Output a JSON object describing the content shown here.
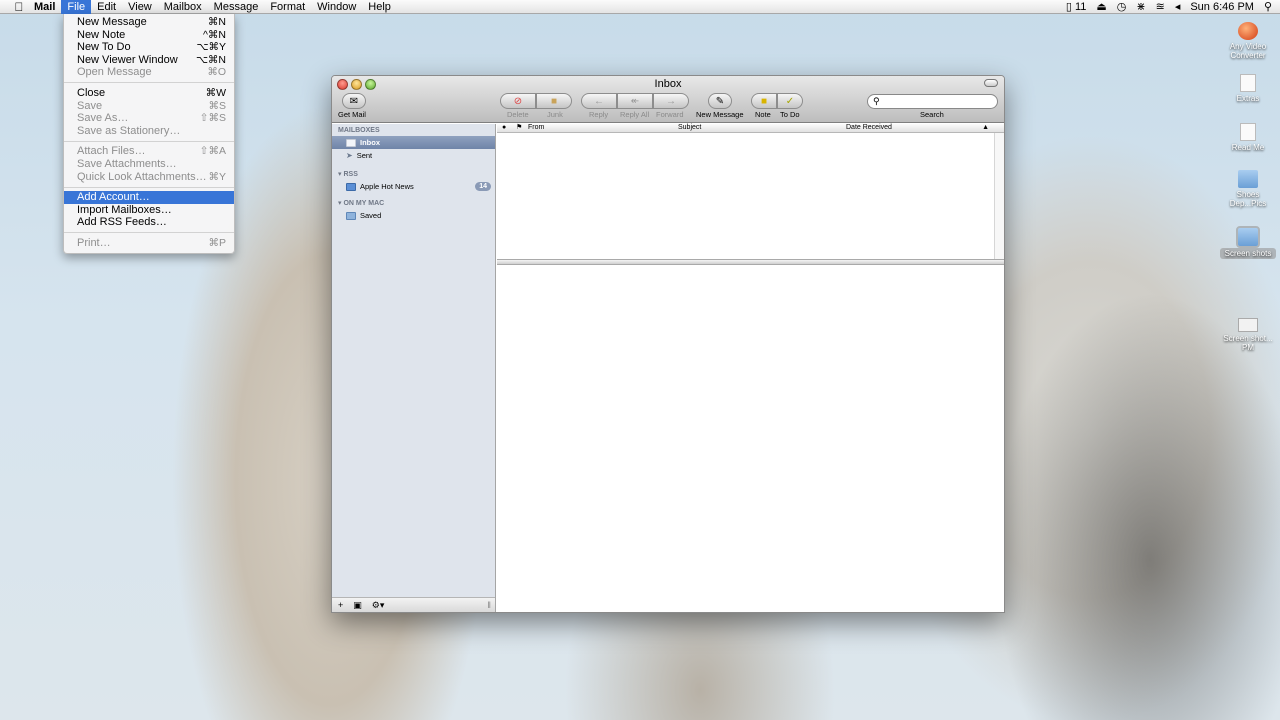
{
  "menubar": {
    "app": "Mail",
    "items": [
      "File",
      "Edit",
      "View",
      "Mailbox",
      "Message",
      "Format",
      "Window",
      "Help"
    ],
    "active": "File",
    "status": {
      "battery": "11",
      "clock": "Sun 6:46 PM"
    }
  },
  "file_menu": {
    "groups": [
      [
        {
          "label": "New Message",
          "shortcut": "⌘N",
          "enabled": true
        },
        {
          "label": "New Note",
          "shortcut": "^⌘N",
          "enabled": true
        },
        {
          "label": "New To Do",
          "shortcut": "⌥⌘Y",
          "enabled": true
        },
        {
          "label": "New Viewer Window",
          "shortcut": "⌥⌘N",
          "enabled": true
        },
        {
          "label": "Open Message",
          "shortcut": "⌘O",
          "enabled": false
        }
      ],
      [
        {
          "label": "Close",
          "shortcut": "⌘W",
          "enabled": true
        },
        {
          "label": "Save",
          "shortcut": "⌘S",
          "enabled": false
        },
        {
          "label": "Save As…",
          "shortcut": "⇧⌘S",
          "enabled": false
        },
        {
          "label": "Save as Stationery…",
          "shortcut": "",
          "enabled": false
        }
      ],
      [
        {
          "label": "Attach Files…",
          "shortcut": "⇧⌘A",
          "enabled": false
        },
        {
          "label": "Save Attachments…",
          "shortcut": "",
          "enabled": false
        },
        {
          "label": "Quick Look Attachments…",
          "shortcut": "⌘Y",
          "enabled": false
        }
      ],
      [
        {
          "label": "Add Account…",
          "shortcut": "",
          "enabled": true,
          "highlighted": true
        },
        {
          "label": "Import Mailboxes…",
          "shortcut": "",
          "enabled": true
        },
        {
          "label": "Add RSS Feeds…",
          "shortcut": "",
          "enabled": true
        }
      ],
      [
        {
          "label": "Print…",
          "shortcut": "⌘P",
          "enabled": false
        }
      ]
    ]
  },
  "window": {
    "title": "Inbox",
    "toolbar": {
      "get_mail": "Get Mail",
      "delete": "Delete",
      "junk": "Junk",
      "reply": "Reply",
      "reply_all": "Reply All",
      "forward": "Forward",
      "new_message": "New Message",
      "note": "Note",
      "todo": "To Do",
      "search_label": "Search",
      "search_value": ""
    },
    "sidebar": {
      "mailboxes_header": "MAILBOXES",
      "inbox": "Inbox",
      "sent": "Sent",
      "rss_header": "RSS",
      "rss_feed": "Apple Hot News",
      "rss_count": "14",
      "on_my_mac_header": "ON MY MAC",
      "saved": "Saved"
    },
    "columns": {
      "status": "●",
      "flag": "⚑",
      "from": "From",
      "subject": "Subject",
      "date": "Date Received"
    }
  },
  "desktop_icons": [
    {
      "label": "Any Video Converter",
      "icon": "app-icon"
    },
    {
      "label": "Extras",
      "icon": "document-icon"
    },
    {
      "label": "Read Me",
      "icon": "document-icon"
    },
    {
      "label": "Shoes Dep...Pics",
      "icon": "folder-icon"
    },
    {
      "label": "Screen shots",
      "icon": "folder-icon"
    },
    {
      "label": "Screen shot... PM",
      "icon": "image-icon"
    }
  ]
}
